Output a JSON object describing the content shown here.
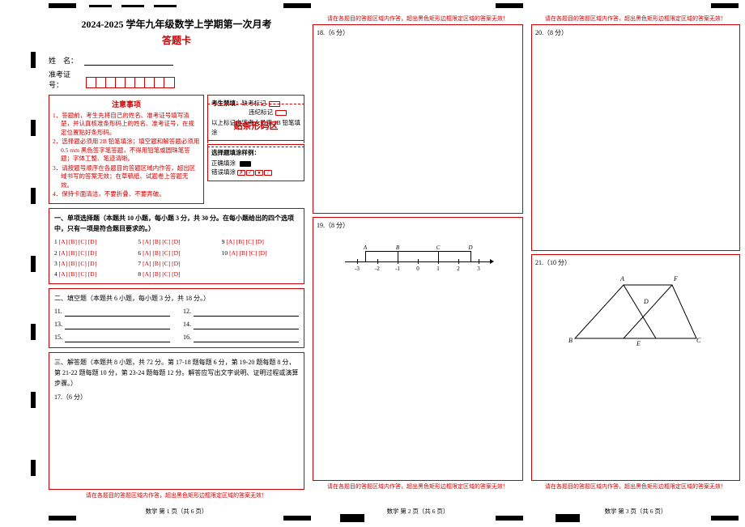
{
  "title": "2024-2025 学年九年级数学上学期第一次月考",
  "subtitle": "答题卡",
  "info": {
    "name_label": "姓　名：",
    "ticket_label": "准考证号："
  },
  "barcode_label": "贴条形码区",
  "notice": {
    "header": "注意事项",
    "items": [
      "1．答题前，考生先将自己的姓名、准考证号填写清楚，并认真核准条形码上的姓名、准考证号，在规定位置贴好条形码。",
      "2．选择题必须用 2B 铅笔填涂；填空题和解答题必须用 0.5 mm 黑色签字笔答题，不得用铅笔或圆珠笔答题；字体工整、笔迹清晰。",
      "3．请按题号顺序在各题目的答题区域内作答，超出区域书写的答案无效；在草稿纸、试题卷上答题无效。",
      "4．保持卡面清洁，不要折叠、不要弄破。"
    ]
  },
  "exam_fill": {
    "header": "考生禁填：",
    "miss": "缺考标记",
    "violate": "违纪标记",
    "note": "以上标记由监考人员用 2B 铅笔填涂"
  },
  "sample": {
    "header": "选择题填涂样例：",
    "right": "正确填涂",
    "wrong": "错误填涂",
    "wrong_marks": [
      "✗",
      "✓",
      "●",
      "/"
    ]
  },
  "section1": {
    "header": "一、单项选择题（本题共 10 小题，每小题 3 分，共 30 分。在每小题给出的四个选项中，只有一项是符合题目要求的。）",
    "opts": "[A] [B] [C] [D]",
    "rows": [
      {
        "n": "1",
        "n2": "5",
        "n3": "9"
      },
      {
        "n": "2",
        "n2": "6",
        "n3": "10"
      },
      {
        "n": "3",
        "n2": "7",
        "n3": ""
      },
      {
        "n": "4",
        "n2": "8",
        "n3": ""
      }
    ]
  },
  "section2": {
    "header": "二、填空题（本题共 6 小题，每小题 3 分，共 18 分。）",
    "nums": [
      "11.",
      "12.",
      "13.",
      "14.",
      "15.",
      "16."
    ]
  },
  "section3": {
    "header": "三、解答题（本题共 8 小题，共 72 分。第 17-18 题每题 6 分，第 19-20 题每题 8 分，第 21-22 题每题 10 分，第 23-24 题每题 12 分。解答应写出文字说明、证明过程或演算步骤。）",
    "q17": "17.（6 分）"
  },
  "q18": "18.（6 分）",
  "q19": {
    "label": "19.（8 分）",
    "number_line": {
      "ticks": [
        -3,
        -2,
        -1,
        0,
        1,
        2,
        3
      ],
      "points": {
        "A_label": "A",
        "B_label": "B",
        "C_label": "C",
        "D_label": "D"
      }
    }
  },
  "q20": "20.（8 分）",
  "q21": {
    "label": "21.（10 分）",
    "fig_labels": {
      "A": "A",
      "B": "B",
      "C": "C",
      "D": "D",
      "E": "E",
      "F": "F"
    }
  },
  "warn_text": "请在各题目的答题区域内作答，超出黑色矩形边框限定区域的答案无效！",
  "footers": {
    "p1": "数学 第 1 页（共 6 页）",
    "p2": "数学 第 2 页（共 6 页）",
    "p3": "数学 第 3 页（共 6 页）"
  },
  "chart_data": {
    "type": "table",
    "description": "Answer sheet. Section I: 10 multiple-choice questions worth 3 points each (30 total), options A–D. Section II: 6 fill-in blanks worth 3 points each (18 total), items 11–16. Section III: 8 free-response questions worth 72 total — Q17–18 6 pts each, Q19–20 8 pts each, Q21–22 10 pts each, Q23–24 12 pts each. Q19 shows a number line with integer ticks −3 to 3 and labeled points A, B, C, D. Q21 shows overlapping triangles with vertices labeled A, B, C, D, E, F."
  }
}
